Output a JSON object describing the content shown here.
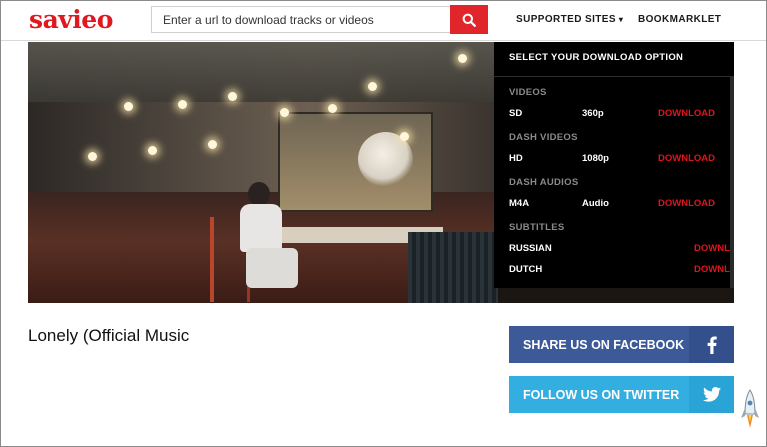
{
  "brand": {
    "logo_text": "savieo",
    "accent": "#e0181f"
  },
  "search": {
    "placeholder": "Enter a url to download tracks or videos",
    "icon": "search-icon"
  },
  "nav": {
    "supported_sites": "SUPPORTED SITES",
    "bookmarklet": "BOOKMARKLET"
  },
  "download_panel": {
    "title": "SELECT YOUR DOWNLOAD OPTION",
    "sections": {
      "videos": "VIDEOS",
      "dash_videos": "DASH VIDEOS",
      "dash_audios": "DASH AUDIOS",
      "subtitles": "SUBTITLES"
    },
    "rows": {
      "sd": {
        "format": "SD",
        "quality": "360p",
        "action": "DOWNLOAD"
      },
      "hd": {
        "format": "HD",
        "quality": "1080p",
        "action": "DOWNLOAD"
      },
      "m4a": {
        "format": "M4A",
        "quality": "Audio",
        "action": "DOWNLOAD"
      },
      "russian": {
        "format": "RUSSIAN",
        "action": "DOWNL"
      },
      "dutch": {
        "format": "DUTCH",
        "action": "DOWNL"
      }
    }
  },
  "song": {
    "title": "Lonely (Official Music"
  },
  "social": {
    "facebook_label": "SHARE US ON FACEBOOK",
    "twitter_label": "FOLLOW US ON TWITTER",
    "facebook_color": "#3d5a98",
    "twitter_color": "#33aee0"
  }
}
